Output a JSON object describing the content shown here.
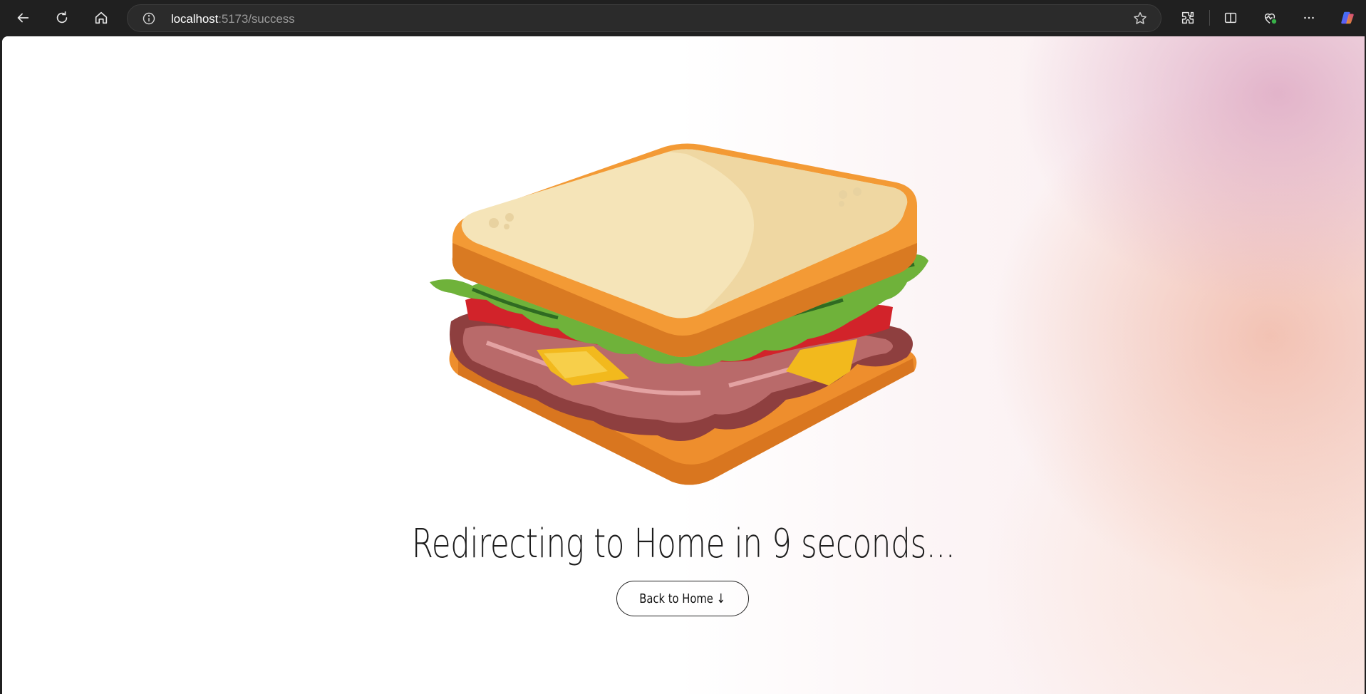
{
  "browser": {
    "url_host": "localhost",
    "url_path": ":5173/success"
  },
  "page": {
    "headline": "Redirecting to Home in 9 seconds...",
    "back_button_label": "Back to Home ↓"
  },
  "colors": {
    "bread": "#f39a35",
    "bread_top": "#f6e6bc",
    "lettuce": "#7cbd3c",
    "tomato": "#d9262b",
    "ham": "#9a4a4a",
    "cheese": "#f2b91d"
  }
}
